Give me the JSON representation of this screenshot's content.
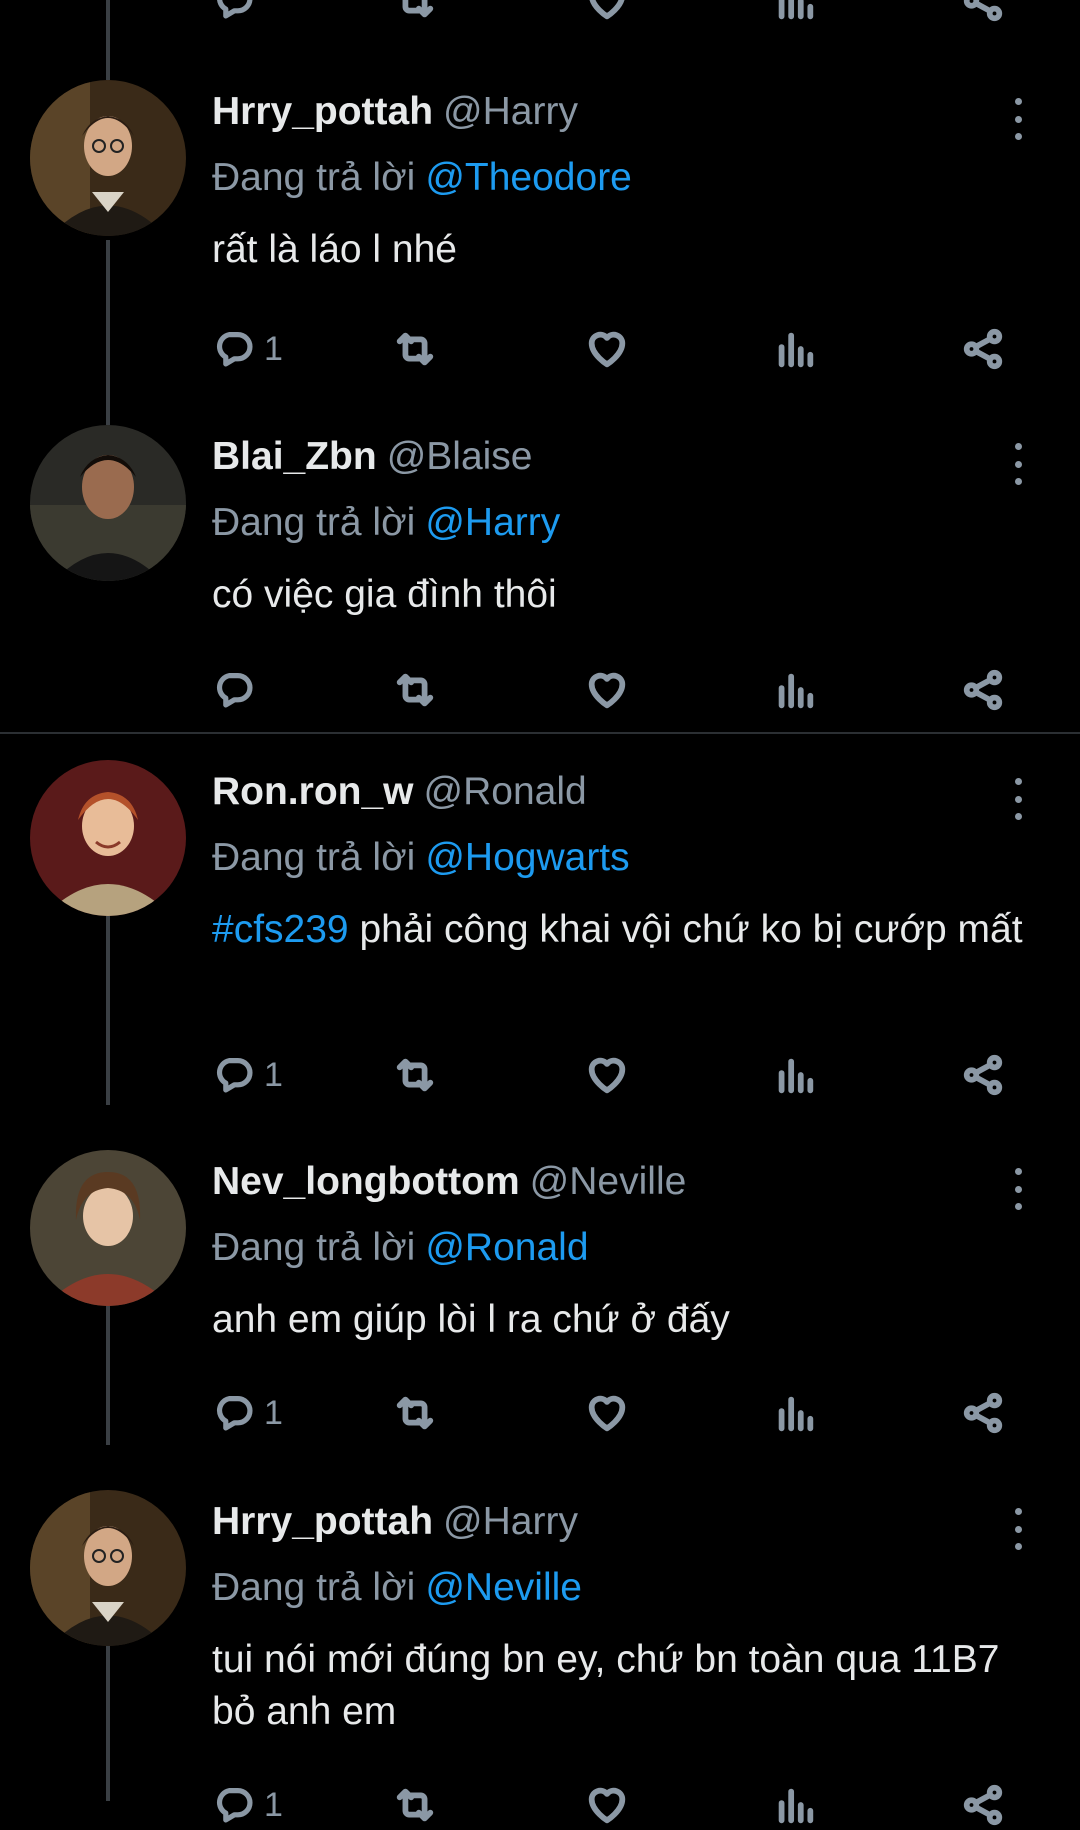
{
  "reply_prefix": "Đang trả lời",
  "tweets": [
    {
      "name": "Hrry_pottah",
      "handle": "@Harry",
      "reply_to": "@Theodore",
      "hashtag": "",
      "text": "rất là láo l nhé",
      "reply_count": "1"
    },
    {
      "name": "Blai_Zbn",
      "handle": "@Blaise",
      "reply_to": "@Harry",
      "hashtag": "",
      "text": "có việc gia đình thôi",
      "reply_count": ""
    },
    {
      "name": "Ron.ron_w",
      "handle": "@Ronald",
      "reply_to": "@Hogwarts",
      "hashtag": "#cfs239",
      "text": " phải công khai vội chứ ko bị cướp mất",
      "reply_count": "1"
    },
    {
      "name": "Nev_longbottom",
      "handle": "@Neville",
      "reply_to": "@Ronald",
      "hashtag": "",
      "text": "anh em giúp lòi l ra chứ ở đấy",
      "reply_count": "1"
    },
    {
      "name": "Hrry_pottah",
      "handle": "@Harry",
      "reply_to": "@Neville",
      "hashtag": "",
      "text": "tui nói mới đúng bn ey, chứ bn toàn qua 11B7 bỏ anh em",
      "reply_count": "1"
    }
  ],
  "colors": {
    "background": "#000000",
    "text": "#e7e9ea",
    "muted": "#8b98a5",
    "link": "#1d9bf0"
  }
}
